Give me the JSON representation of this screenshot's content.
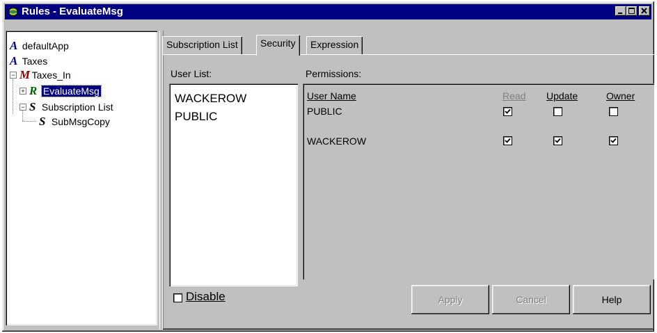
{
  "window": {
    "title": "Rules - EvaluateMsg"
  },
  "tree": {
    "items": [
      {
        "label": "defaultApp",
        "icon": "app-a-icon"
      },
      {
        "label": "Taxes",
        "icon": "app-a-icon"
      },
      {
        "label": "Taxes_In",
        "icon": "message-m-icon"
      },
      {
        "label": "EvaluateMsg",
        "icon": "rule-r-icon",
        "selected": true
      },
      {
        "label": "Subscription List",
        "icon": "subscription-s-icon"
      },
      {
        "label": "SubMsgCopy",
        "icon": "subscription-s-icon"
      }
    ]
  },
  "tabs": [
    {
      "label": "Subscription List"
    },
    {
      "label": "Security",
      "active": true
    },
    {
      "label": "Expression"
    }
  ],
  "security": {
    "user_list_label": "User List:",
    "users": [
      "WACKEROW",
      "PUBLIC"
    ],
    "permissions_label": "Permissions:",
    "columns": [
      "User Name",
      "Read",
      "Update",
      "Owner"
    ],
    "rows": [
      {
        "name": "PUBLIC",
        "read": true,
        "update": false,
        "owner": false
      },
      {
        "name": "WACKEROW",
        "read": true,
        "update": true,
        "owner": true
      }
    ],
    "disable_label": "Disable",
    "disable_checked": false
  },
  "buttons": {
    "apply": "Apply",
    "cancel": "Cancel",
    "help": "Help"
  },
  "colors": {
    "titlebar": "#000080",
    "face": "#c0c0c0",
    "selection": "#000080"
  }
}
